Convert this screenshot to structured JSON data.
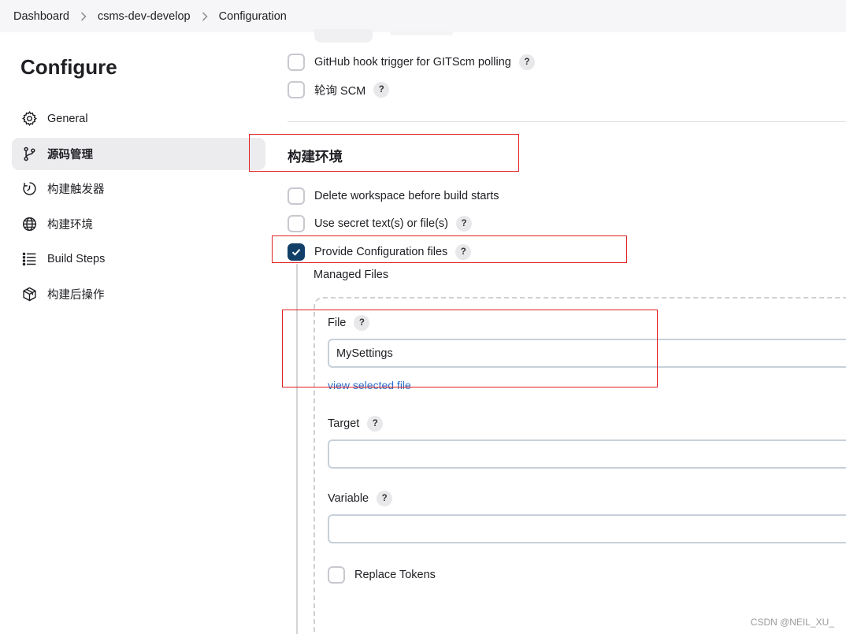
{
  "breadcrumb": {
    "items": [
      "Dashboard",
      "csms-dev-develop",
      "Configuration"
    ]
  },
  "sidebar": {
    "title": "Configure",
    "items": [
      {
        "label": "General",
        "icon": "gear-icon",
        "active": false
      },
      {
        "label": "源码管理",
        "icon": "branch-icon",
        "active": true
      },
      {
        "label": "构建触发器",
        "icon": "clock-icon",
        "active": false
      },
      {
        "label": "构建环境",
        "icon": "globe-icon",
        "active": false
      },
      {
        "label": "Build Steps",
        "icon": "list-icon",
        "active": false
      },
      {
        "label": "构建后操作",
        "icon": "package-icon",
        "active": false
      }
    ]
  },
  "triggers": {
    "github_hook": {
      "label": "GitHub hook trigger for GITScm polling",
      "checked": false
    },
    "poll_scm": {
      "label": "轮询 SCM",
      "checked": false
    }
  },
  "build_env": {
    "title": "构建环境",
    "delete_workspace": {
      "label": "Delete workspace before build starts",
      "checked": false
    },
    "secret_text": {
      "label": "Use secret text(s) or file(s)",
      "checked": false
    },
    "provide_config": {
      "label": "Provide Configuration files",
      "checked": true
    },
    "managed_files_label": "Managed Files",
    "file": {
      "label": "File",
      "value": "MySettings",
      "link": "view selected file"
    },
    "target": {
      "label": "Target",
      "value": ""
    },
    "variable": {
      "label": "Variable",
      "value": ""
    },
    "replace_tokens": {
      "label": "Replace Tokens",
      "checked": false
    }
  },
  "help_label": "?",
  "watermark": "CSDN @NEIL_XU_",
  "colors": {
    "checkbox_checked": "#113f67",
    "link": "#2a6fc9",
    "highlight_box": "#e02020"
  }
}
